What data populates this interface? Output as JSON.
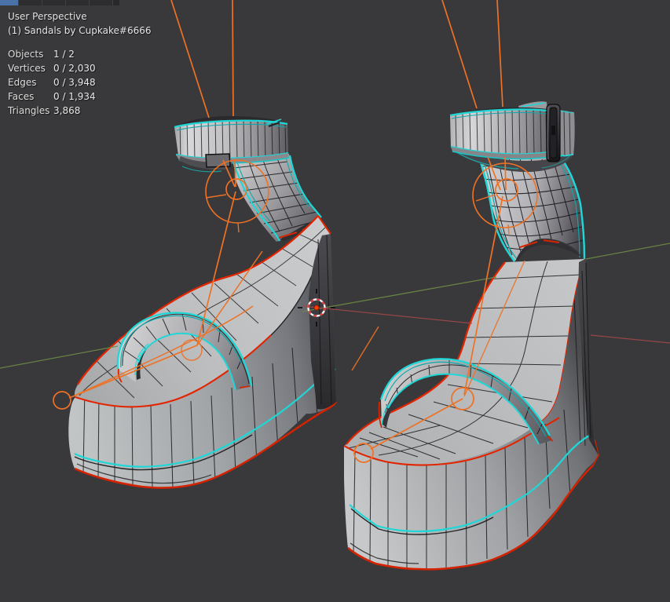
{
  "viewport": {
    "view_label": "User Perspective",
    "collection_label": "(1) Sandals by Cupkake#6666",
    "stats": [
      {
        "label": "Objects",
        "value": "1 / 2"
      },
      {
        "label": "Vertices",
        "value": "0 / 2,030"
      },
      {
        "label": "Edges",
        "value": "0 / 3,948"
      },
      {
        "label": "Faces",
        "value": "0 / 1,934"
      },
      {
        "label": "Triangles",
        "value": "3,868"
      }
    ],
    "colors": {
      "background": "#39393b",
      "edge_highlight_cyan": "#1ed7d7",
      "edge_mark_red": "#e22400",
      "bone_orange": "#ee7125",
      "axis_x_red": "#a14848",
      "axis_y_green": "#6d8b45",
      "mesh_surface_light": "#c9cacb",
      "mesh_surface_dark": "#4a4a4e",
      "text": "#e4e4e4",
      "tab_blue": "#4a72a8"
    },
    "icons": {
      "cursor": "3d-cursor",
      "armature": "bone-wires"
    }
  }
}
